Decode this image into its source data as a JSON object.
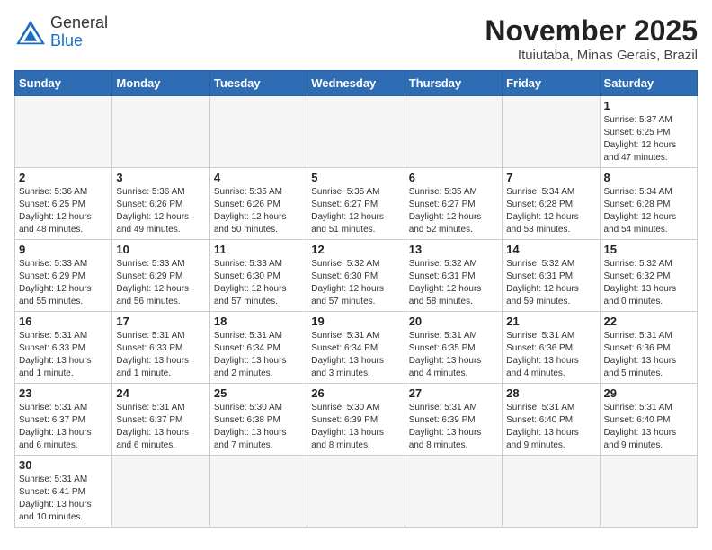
{
  "header": {
    "logo_general": "General",
    "logo_blue": "Blue",
    "month": "November 2025",
    "location": "Ituiutaba, Minas Gerais, Brazil"
  },
  "days_of_week": [
    "Sunday",
    "Monday",
    "Tuesday",
    "Wednesday",
    "Thursday",
    "Friday",
    "Saturday"
  ],
  "weeks": [
    [
      {
        "day": "",
        "info": ""
      },
      {
        "day": "",
        "info": ""
      },
      {
        "day": "",
        "info": ""
      },
      {
        "day": "",
        "info": ""
      },
      {
        "day": "",
        "info": ""
      },
      {
        "day": "",
        "info": ""
      },
      {
        "day": "1",
        "info": "Sunrise: 5:37 AM\nSunset: 6:25 PM\nDaylight: 12 hours\nand 47 minutes."
      }
    ],
    [
      {
        "day": "2",
        "info": "Sunrise: 5:36 AM\nSunset: 6:25 PM\nDaylight: 12 hours\nand 48 minutes."
      },
      {
        "day": "3",
        "info": "Sunrise: 5:36 AM\nSunset: 6:26 PM\nDaylight: 12 hours\nand 49 minutes."
      },
      {
        "day": "4",
        "info": "Sunrise: 5:35 AM\nSunset: 6:26 PM\nDaylight: 12 hours\nand 50 minutes."
      },
      {
        "day": "5",
        "info": "Sunrise: 5:35 AM\nSunset: 6:27 PM\nDaylight: 12 hours\nand 51 minutes."
      },
      {
        "day": "6",
        "info": "Sunrise: 5:35 AM\nSunset: 6:27 PM\nDaylight: 12 hours\nand 52 minutes."
      },
      {
        "day": "7",
        "info": "Sunrise: 5:34 AM\nSunset: 6:28 PM\nDaylight: 12 hours\nand 53 minutes."
      },
      {
        "day": "8",
        "info": "Sunrise: 5:34 AM\nSunset: 6:28 PM\nDaylight: 12 hours\nand 54 minutes."
      }
    ],
    [
      {
        "day": "9",
        "info": "Sunrise: 5:33 AM\nSunset: 6:29 PM\nDaylight: 12 hours\nand 55 minutes."
      },
      {
        "day": "10",
        "info": "Sunrise: 5:33 AM\nSunset: 6:29 PM\nDaylight: 12 hours\nand 56 minutes."
      },
      {
        "day": "11",
        "info": "Sunrise: 5:33 AM\nSunset: 6:30 PM\nDaylight: 12 hours\nand 57 minutes."
      },
      {
        "day": "12",
        "info": "Sunrise: 5:32 AM\nSunset: 6:30 PM\nDaylight: 12 hours\nand 57 minutes."
      },
      {
        "day": "13",
        "info": "Sunrise: 5:32 AM\nSunset: 6:31 PM\nDaylight: 12 hours\nand 58 minutes."
      },
      {
        "day": "14",
        "info": "Sunrise: 5:32 AM\nSunset: 6:31 PM\nDaylight: 12 hours\nand 59 minutes."
      },
      {
        "day": "15",
        "info": "Sunrise: 5:32 AM\nSunset: 6:32 PM\nDaylight: 13 hours\nand 0 minutes."
      }
    ],
    [
      {
        "day": "16",
        "info": "Sunrise: 5:31 AM\nSunset: 6:33 PM\nDaylight: 13 hours\nand 1 minute."
      },
      {
        "day": "17",
        "info": "Sunrise: 5:31 AM\nSunset: 6:33 PM\nDaylight: 13 hours\nand 1 minute."
      },
      {
        "day": "18",
        "info": "Sunrise: 5:31 AM\nSunset: 6:34 PM\nDaylight: 13 hours\nand 2 minutes."
      },
      {
        "day": "19",
        "info": "Sunrise: 5:31 AM\nSunset: 6:34 PM\nDaylight: 13 hours\nand 3 minutes."
      },
      {
        "day": "20",
        "info": "Sunrise: 5:31 AM\nSunset: 6:35 PM\nDaylight: 13 hours\nand 4 minutes."
      },
      {
        "day": "21",
        "info": "Sunrise: 5:31 AM\nSunset: 6:36 PM\nDaylight: 13 hours\nand 4 minutes."
      },
      {
        "day": "22",
        "info": "Sunrise: 5:31 AM\nSunset: 6:36 PM\nDaylight: 13 hours\nand 5 minutes."
      }
    ],
    [
      {
        "day": "23",
        "info": "Sunrise: 5:31 AM\nSunset: 6:37 PM\nDaylight: 13 hours\nand 6 minutes."
      },
      {
        "day": "24",
        "info": "Sunrise: 5:31 AM\nSunset: 6:37 PM\nDaylight: 13 hours\nand 6 minutes."
      },
      {
        "day": "25",
        "info": "Sunrise: 5:30 AM\nSunset: 6:38 PM\nDaylight: 13 hours\nand 7 minutes."
      },
      {
        "day": "26",
        "info": "Sunrise: 5:30 AM\nSunset: 6:39 PM\nDaylight: 13 hours\nand 8 minutes."
      },
      {
        "day": "27",
        "info": "Sunrise: 5:31 AM\nSunset: 6:39 PM\nDaylight: 13 hours\nand 8 minutes."
      },
      {
        "day": "28",
        "info": "Sunrise: 5:31 AM\nSunset: 6:40 PM\nDaylight: 13 hours\nand 9 minutes."
      },
      {
        "day": "29",
        "info": "Sunrise: 5:31 AM\nSunset: 6:40 PM\nDaylight: 13 hours\nand 9 minutes."
      }
    ],
    [
      {
        "day": "30",
        "info": "Sunrise: 5:31 AM\nSunset: 6:41 PM\nDaylight: 13 hours\nand 10 minutes."
      },
      {
        "day": "",
        "info": ""
      },
      {
        "day": "",
        "info": ""
      },
      {
        "day": "",
        "info": ""
      },
      {
        "day": "",
        "info": ""
      },
      {
        "day": "",
        "info": ""
      },
      {
        "day": "",
        "info": ""
      }
    ]
  ]
}
